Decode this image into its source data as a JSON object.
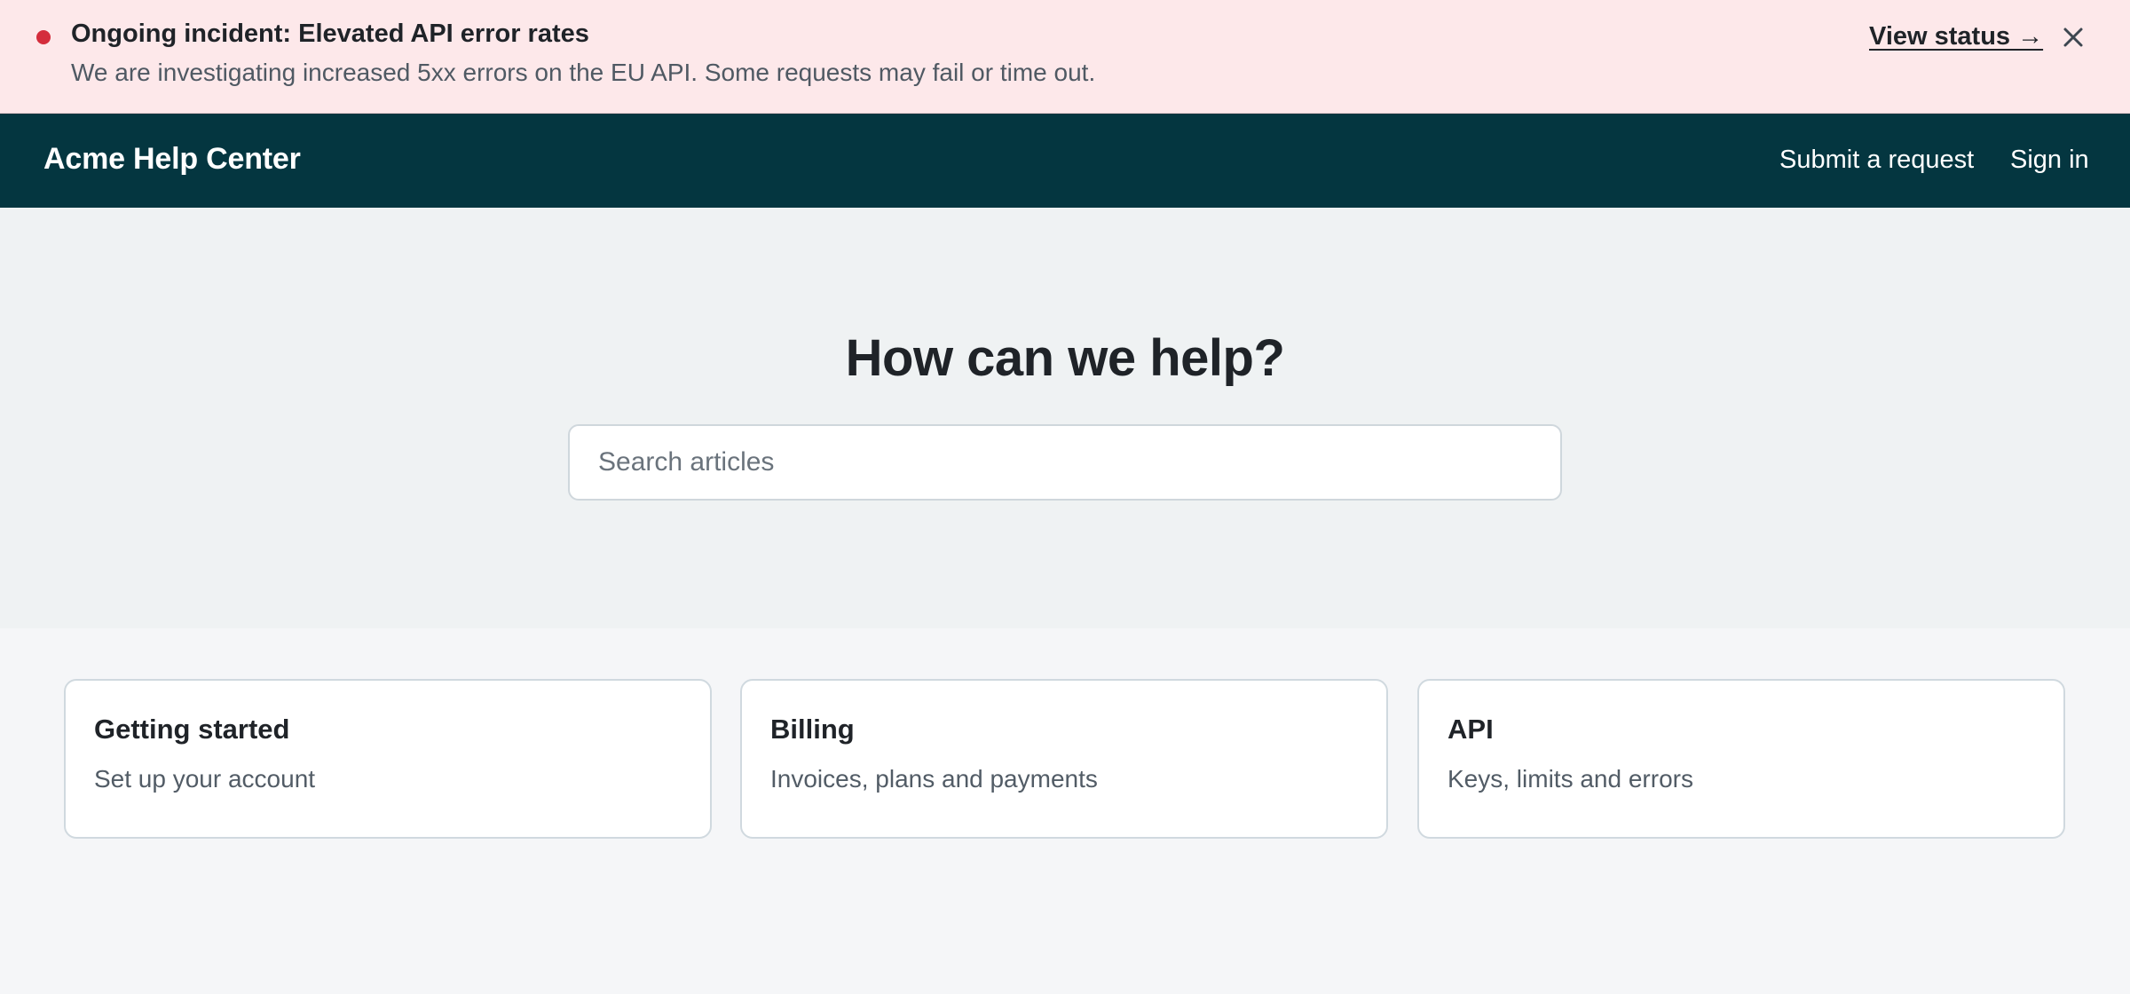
{
  "banner": {
    "title": "Ongoing incident: Elevated API error rates",
    "message": "We are investigating increased 5xx errors on the EU API. Some requests may fail or time out.",
    "link_label": "View status →",
    "close_icon": "close-icon",
    "status_color": "#d42d3c",
    "background_color": "#fde8ea"
  },
  "header": {
    "brand": "Acme Help Center",
    "nav": {
      "submit_request": "Submit a request",
      "sign_in": "Sign in"
    },
    "background_color": "#043640"
  },
  "hero": {
    "title": "How can we help?",
    "search": {
      "placeholder": "Search articles",
      "value": ""
    }
  },
  "categories": [
    {
      "title": "Getting started",
      "description": "Set up your account"
    },
    {
      "title": "Billing",
      "description": "Invoices, plans and payments"
    },
    {
      "title": "API",
      "description": "Keys, limits and errors"
    }
  ]
}
